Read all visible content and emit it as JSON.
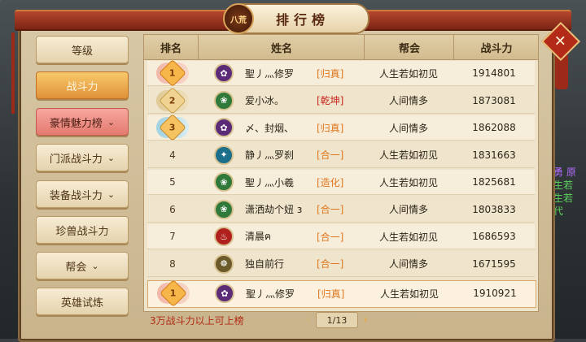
{
  "window": {
    "title": "排行榜",
    "badge": "八荒",
    "close_label": "✕"
  },
  "sidebar": {
    "items": [
      {
        "label": "等级",
        "state": "normal",
        "chevron": false
      },
      {
        "label": "战斗力",
        "state": "active",
        "chevron": false
      },
      {
        "label": "豪情魅力榜",
        "state": "highlight",
        "chevron": true
      },
      {
        "label": "门派战斗力",
        "state": "normal",
        "chevron": true
      },
      {
        "label": "装备战斗力",
        "state": "normal",
        "chevron": true
      },
      {
        "label": "珍兽战斗力",
        "state": "normal",
        "chevron": false
      },
      {
        "label": "帮会",
        "state": "normal",
        "chevron": true
      },
      {
        "label": "英雄试炼",
        "state": "normal",
        "chevron": false
      }
    ],
    "chevron_glyph": "⌄"
  },
  "table": {
    "headers": {
      "rank": "排名",
      "name": "姓名",
      "guild": "帮会",
      "power": "战斗力"
    },
    "rows": [
      {
        "rank": "1",
        "medal": "gold",
        "icon_color": "#5b2b78",
        "icon_glyph": "✿",
        "name": "聖丿灬修罗",
        "title": "[归真]",
        "title_color": "#e07820",
        "guild": "人生若如初见",
        "power": "1914801"
      },
      {
        "rank": "2",
        "medal": "silver",
        "icon_color": "#2f7a3a",
        "icon_glyph": "❀",
        "name": "爱小冰。",
        "title": "[乾坤]",
        "title_color": "#c8261c",
        "guild": "人间情多",
        "power": "1873081"
      },
      {
        "rank": "3",
        "medal": "bronze",
        "icon_color": "#5b2b78",
        "icon_glyph": "✿",
        "name": "〆、封烟、",
        "title": "[归真]",
        "title_color": "#e07820",
        "guild": "人间情多",
        "power": "1862088"
      },
      {
        "rank": "4",
        "medal": "",
        "icon_color": "#1c6f8a",
        "icon_glyph": "✦",
        "name": "静丿灬罗刹",
        "title": "[合一]",
        "title_color": "#e07820",
        "guild": "人生若如初见",
        "power": "1831663"
      },
      {
        "rank": "5",
        "medal": "",
        "icon_color": "#2f7a3a",
        "icon_glyph": "❀",
        "name": "聖丿灬小羲",
        "title": "[造化]",
        "title_color": "#e07820",
        "guild": "人生若如初见",
        "power": "1825681"
      },
      {
        "rank": "6",
        "medal": "",
        "icon_color": "#2f7a3a",
        "icon_glyph": "❀",
        "name": "潇洒劫个妞 з",
        "title": "[合一]",
        "title_color": "#e07820",
        "guild": "人间情多",
        "power": "1803833"
      },
      {
        "rank": "7",
        "medal": "",
        "icon_color": "#b0201c",
        "icon_glyph": "♨",
        "name": "清晨ฅ",
        "title": "[合一]",
        "title_color": "#e07820",
        "guild": "人生若如初见",
        "power": "1686593"
      },
      {
        "rank": "8",
        "medal": "",
        "icon_color": "#6b5a2a",
        "icon_glyph": "☸",
        "name": "独自前行",
        "title": "[合一]",
        "title_color": "#e07820",
        "guild": "人间情多",
        "power": "1671595"
      }
    ],
    "self_row": {
      "rank": "1",
      "medal": "gold",
      "icon_color": "#5b2b78",
      "icon_glyph": "✿",
      "name": "聖丿灬修罗",
      "title": "[归真]",
      "title_color": "#e07820",
      "guild": "人生若如初见",
      "power": "1910921"
    }
  },
  "footer": {
    "note": "3万战斗力以上可上榜",
    "page": "1/13",
    "prev": "‹",
    "next": "›"
  },
  "chat_fragments": [
    "神勇 原",
    "人生若",
    "人生若",
    "一代"
  ]
}
